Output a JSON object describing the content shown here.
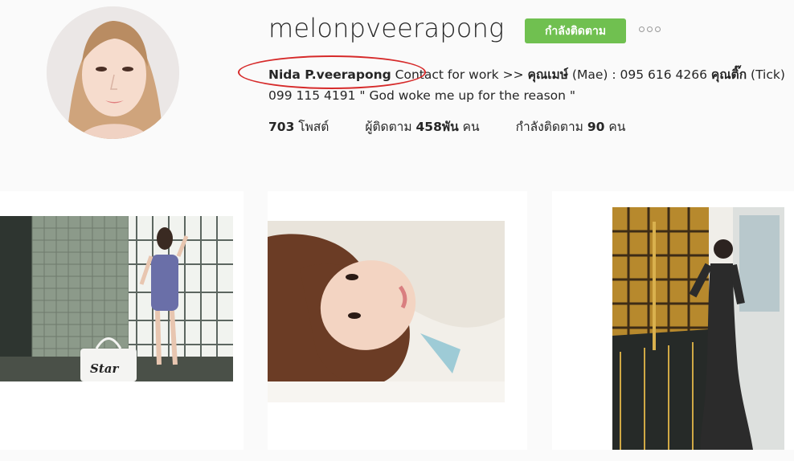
{
  "profile": {
    "username": "melonpveerapong",
    "follow_button_label": "กำลังติดตาม",
    "bio": {
      "name": "Nida P.veerapong",
      "contact_intro": " Contact for work >> ",
      "contact1_name": "คุณเมษ์",
      "contact1_detail": " (Mae) : 095 616 4266 ",
      "contact2_name": "คุณติ๊ก",
      "contact2_detail": " (Tick)",
      "line2": "099 115 4191 \" God woke me up for the reason \""
    },
    "stats": {
      "posts_count": "703",
      "posts_label": "โพสต์",
      "followers_label": "ผู้ติดตาม",
      "followers_count": "458พัน",
      "followers_unit": "คน",
      "following_label": "กำลังติดตาม",
      "following_count": "90",
      "following_unit": "คน"
    }
  },
  "posts": [
    {
      "image": "photo-woman-standing-by-gate",
      "bag_text": "Star"
    },
    {
      "image": "photo-selfie-in-bed"
    },
    {
      "image": "photo-woman-by-bookshelf"
    }
  ],
  "colors": {
    "follow_green": "#70c050",
    "highlight_red": "#d62a2a",
    "background": "#fafafa"
  }
}
